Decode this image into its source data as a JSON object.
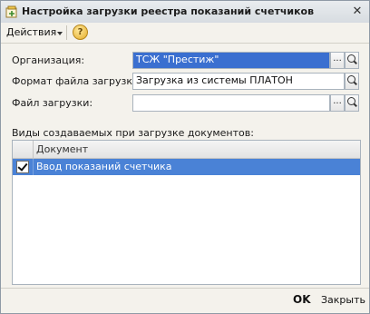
{
  "window": {
    "title": "Настройка загрузки реестра показаний счетчиков"
  },
  "toolbar": {
    "actions_label": "Действия",
    "help_icon": "?"
  },
  "form": {
    "organization_label": "Организация:",
    "organization_value": "ТСЖ \"Престиж\"",
    "format_label": "Формат файла загрузки:",
    "format_value": "Загрузка из системы ПЛАТОН",
    "file_label": "Файл загрузки:",
    "file_value": "",
    "select_button": "..."
  },
  "documents": {
    "section_label": "Виды создаваемых при загрузке документов:",
    "column_header": "Документ",
    "rows": [
      {
        "checked": true,
        "label": "Ввод показаний счетчика"
      }
    ]
  },
  "footer": {
    "ok_label": "OK",
    "close_label": "Закрыть"
  },
  "colors": {
    "selection": "#4a82d6",
    "title_bg": "#d7dce1"
  }
}
